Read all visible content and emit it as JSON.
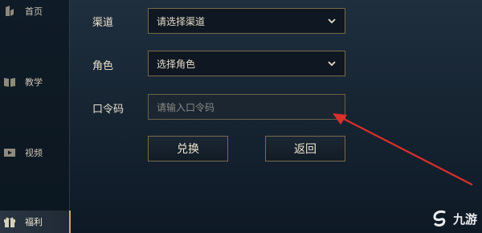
{
  "sidebar": {
    "items": [
      {
        "label": "首页",
        "icon": "home-icon",
        "active": false
      },
      {
        "label": "教学",
        "icon": "book-icon",
        "active": false
      },
      {
        "label": "视频",
        "icon": "video-icon",
        "active": false
      },
      {
        "label": "福利",
        "icon": "gift-icon",
        "active": true
      }
    ]
  },
  "form": {
    "channel": {
      "label": "渠道",
      "value": "请选择渠道"
    },
    "role": {
      "label": "角色",
      "value": "选择角色"
    },
    "code": {
      "label": "口令码",
      "placeholder": "请输入口令码",
      "value": ""
    }
  },
  "buttons": {
    "redeem": "兑换",
    "back": "返回"
  },
  "watermark": {
    "text": "九游"
  },
  "colors": {
    "accent_gold": "#c8aa6e",
    "border_gold": "#77694a",
    "annotation_arrow": "#d9302c"
  }
}
